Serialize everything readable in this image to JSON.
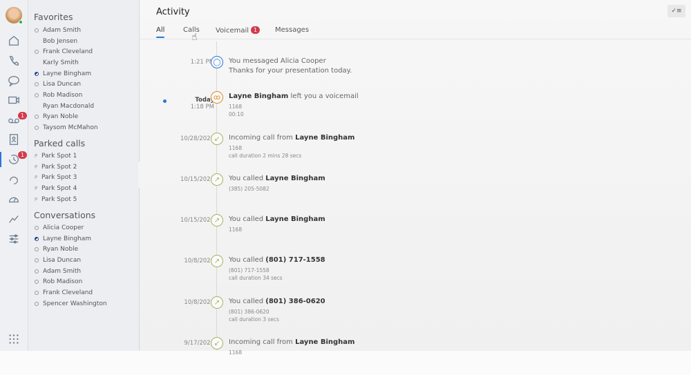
{
  "rail": {
    "items": [
      "avatar",
      "home-icon",
      "phone-icon",
      "chat-icon",
      "video-icon",
      "voicemail-icon",
      "contacts-icon",
      "history-icon",
      "headset-icon",
      "dashboard-icon",
      "analytics-icon",
      "settings-sliders-icon",
      "apps-grid-icon"
    ],
    "voicemail_badge": "1",
    "history_badge": "1",
    "active": "history"
  },
  "panel": {
    "favorites_title": "Favorites",
    "favorites": [
      {
        "name": "Adam Smith",
        "status": "offline"
      },
      {
        "name": "Bob Jensen",
        "status": "none"
      },
      {
        "name": "Frank Cleveland",
        "status": "offline"
      },
      {
        "name": "Karly Smith",
        "status": "none"
      },
      {
        "name": "Layne Bingham",
        "status": "busy"
      },
      {
        "name": "Lisa Duncan",
        "status": "offline"
      },
      {
        "name": "Rob Madison",
        "status": "offline"
      },
      {
        "name": "Ryan Macdonald",
        "status": "none"
      },
      {
        "name": "Ryan Noble",
        "status": "offline"
      },
      {
        "name": "Taysom McMahon",
        "status": "offline"
      }
    ],
    "parked_title": "Parked calls",
    "park_prefix": "P",
    "parked": [
      "Park Spot 1",
      "Park Spot 2",
      "Park Spot 3",
      "Park Spot 4",
      "Park Spot 5"
    ],
    "conversations_title": "Conversations",
    "conversations": [
      {
        "name": "Alicia Cooper",
        "status": "offline"
      },
      {
        "name": "Layne Bingham",
        "status": "busy"
      },
      {
        "name": "Ryan Noble",
        "status": "offline"
      },
      {
        "name": "Lisa Duncan",
        "status": "offline"
      },
      {
        "name": "Adam Smith",
        "status": "offline"
      },
      {
        "name": "Rob Madison",
        "status": "offline"
      },
      {
        "name": "Frank Cleveland",
        "status": "offline"
      },
      {
        "name": "Spencer Washington",
        "status": "offline"
      }
    ],
    "collapse": "‹"
  },
  "main": {
    "title": "Activity",
    "tabs": [
      {
        "label": "All",
        "active": true
      },
      {
        "label": "Calls"
      },
      {
        "label": "Voicemail",
        "badge": "1"
      },
      {
        "label": "Messages"
      }
    ],
    "mark_read": "✓≡",
    "entries": [
      {
        "date": "1:21 PM",
        "type": "message",
        "color": "#2e74d6",
        "pre": "You messaged Alicia Cooper",
        "bold": "",
        "post": "",
        "lines": [
          "Thanks for your presentation today."
        ]
      },
      {
        "date_bold": "Today",
        "date": "1:18 PM",
        "type": "voicemail",
        "color": "#e08a2c",
        "unread": true,
        "pre": "",
        "bold": "Layne Bingham",
        "post": " left you a voicemail",
        "lines": [
          "1168",
          "00:10"
        ]
      },
      {
        "date": "10/28/2020",
        "type": "incoming",
        "color": "#a7b461",
        "pre": "Incoming call from ",
        "bold": "Layne Bingham",
        "post": "",
        "lines": [
          "1168",
          "call duration 2 mins 28 secs"
        ]
      },
      {
        "date": "10/15/2020",
        "type": "outgoing",
        "color": "#a7b461",
        "pre": "You called ",
        "bold": "Layne Bingham",
        "post": "",
        "lines": [
          "(385) 205-5082"
        ]
      },
      {
        "date": "10/15/2020",
        "type": "outgoing",
        "color": "#a7b461",
        "pre": "You called ",
        "bold": "Layne Bingham",
        "post": "",
        "lines": [
          "1168"
        ]
      },
      {
        "date": "10/8/2020",
        "type": "outgoing",
        "color": "#a7b461",
        "pre": "You called ",
        "bold": "(801) 717-1558",
        "post": "",
        "lines": [
          "(801) 717-1558",
          "call duration 34 secs"
        ]
      },
      {
        "date": "10/8/2020",
        "type": "outgoing",
        "color": "#a7b461",
        "pre": "You called ",
        "bold": "(801) 386-0620",
        "post": "",
        "lines": [
          "(801) 386-0620",
          "call duration 3 secs"
        ]
      },
      {
        "date": "9/17/2020",
        "type": "incoming",
        "color": "#a7b461",
        "pre": "Incoming call from ",
        "bold": "Layne Bingham",
        "post": "",
        "lines": [
          "1168"
        ]
      }
    ]
  }
}
